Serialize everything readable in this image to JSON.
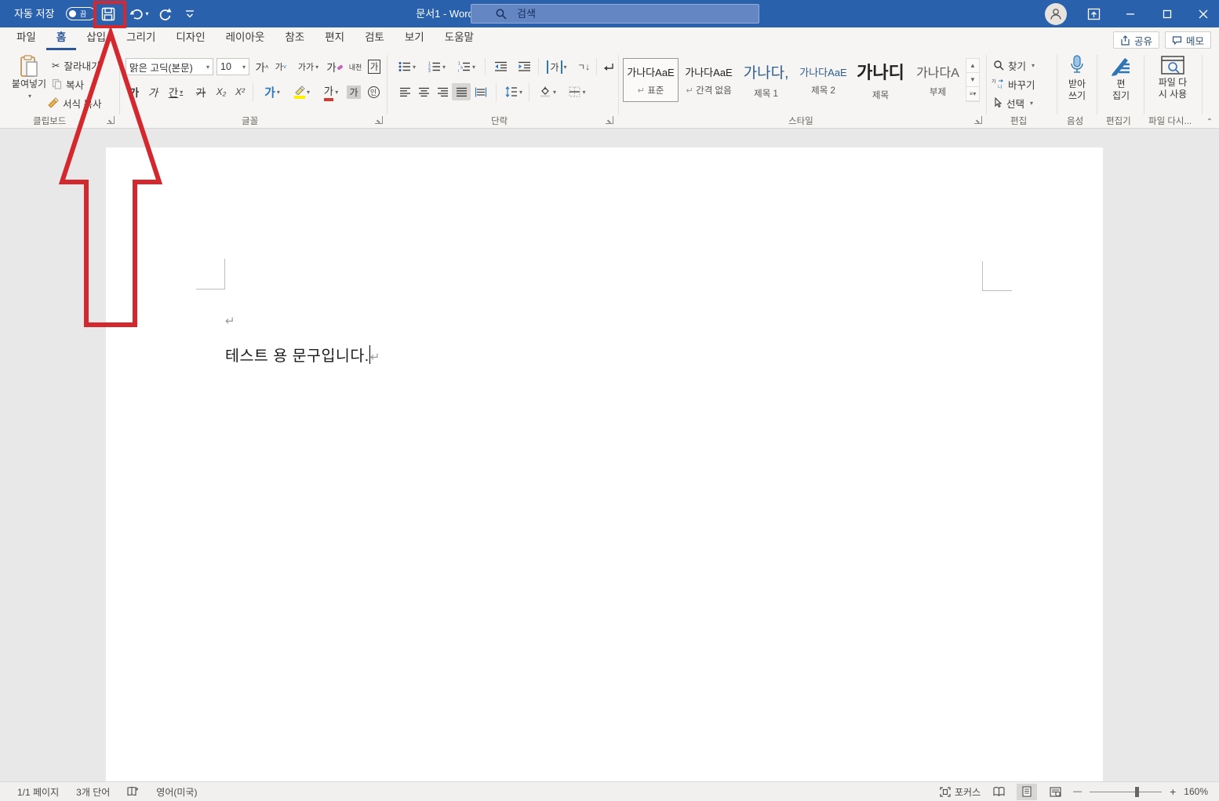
{
  "colors": {
    "title_bar_blue": "#2a61ad",
    "accent_blue": "#2b579a",
    "annotation_red": "#d3282e",
    "ribbon_bg": "#f6f5f4",
    "canvas_gray": "#e9e8e8",
    "highlight_yellow": "#ffee00",
    "font_color_red": "#d43a2f"
  },
  "title_bar": {
    "autosave_label": "자동 저장",
    "autosave_state": "끔",
    "document_title": "문서1  -  Word",
    "search_placeholder": "검색"
  },
  "tabs": {
    "items": [
      "파일",
      "홈",
      "삽입",
      "그리기",
      "디자인",
      "레이아웃",
      "참조",
      "편지",
      "검토",
      "보기",
      "도움말"
    ],
    "selected": "홈"
  },
  "actions": {
    "share": "공유",
    "memo": "메모"
  },
  "ribbon": {
    "clipboard": {
      "label": "클립보드",
      "paste": "붙여넣기",
      "cut": "잘라내기",
      "copy": "복사",
      "format_painter": "서식 복사"
    },
    "font": {
      "label": "글꼴",
      "family": "맑은 고딕(본문)",
      "size": "10",
      "grow": "가",
      "shrink": "가",
      "change_case": "가가",
      "clear_formatting": "가",
      "phonetic_guide": "내천",
      "char_border": "가",
      "bold": "가",
      "italic": "가",
      "underline": "간",
      "strikethrough": "가",
      "subscript": "X₂",
      "superscript": "X²",
      "text_effects": "가",
      "font_color": "가",
      "char_shading": "가",
      "enclose": "인"
    },
    "paragraph": {
      "label": "단락",
      "sort_glyph": "ㄱ"
    },
    "styles": {
      "label": "스타일",
      "items": [
        {
          "sample": "가나다AaE",
          "name": "표준",
          "pilcrow": "↵"
        },
        {
          "sample": "가나다AaE",
          "name": "간격 없음",
          "pilcrow": "↵"
        },
        {
          "sample": "가나다,",
          "name": "제목 1",
          "pilcrow": ""
        },
        {
          "sample": "가나다AaE",
          "name": "제목 2",
          "pilcrow": ""
        },
        {
          "sample": "가나디",
          "name": "제목",
          "pilcrow": ""
        },
        {
          "sample": "가나다A",
          "name": "부제",
          "pilcrow": ""
        }
      ]
    },
    "editing": {
      "label": "편집",
      "find": "찾기",
      "replace": "바꾸기",
      "select": "선택"
    },
    "voice": {
      "label": "음성",
      "dictate": [
        "받아",
        "쓰기"
      ]
    },
    "editor": {
      "label": "편집기",
      "lines": [
        "편",
        "집기"
      ]
    },
    "reuse": {
      "label": "파일 다시...",
      "lines": [
        "파일 다",
        "시 사용"
      ]
    }
  },
  "document": {
    "text": "테스트  용  문구입니다.",
    "pilcrow": "↵"
  },
  "status_bar": {
    "page": "1/1 페이지",
    "words": "3개 단어",
    "language": "영어(미국)",
    "focus": "포커스",
    "zoom": "160%",
    "minus": "—",
    "plus": "+"
  },
  "annotation": {
    "type": "red-arrow-and-box",
    "target": "save-button",
    "color": "#d3282e"
  },
  "icons": {
    "save": "floppy-disk",
    "undo": "arrow-curl-left",
    "redo": "arrow-circle",
    "search": "magnifier",
    "avatar": "person-circle",
    "ribbon_options": "box-chevron-up",
    "minimize": "—",
    "maximize": "□",
    "close": "✕",
    "share": "box-up-arrow",
    "memo": "speech-bubble",
    "dictate": "microphone",
    "editor": "pen-lines",
    "reuse_files": "window-magnifier",
    "proofing": "open-book",
    "focus": "corner-brackets"
  }
}
